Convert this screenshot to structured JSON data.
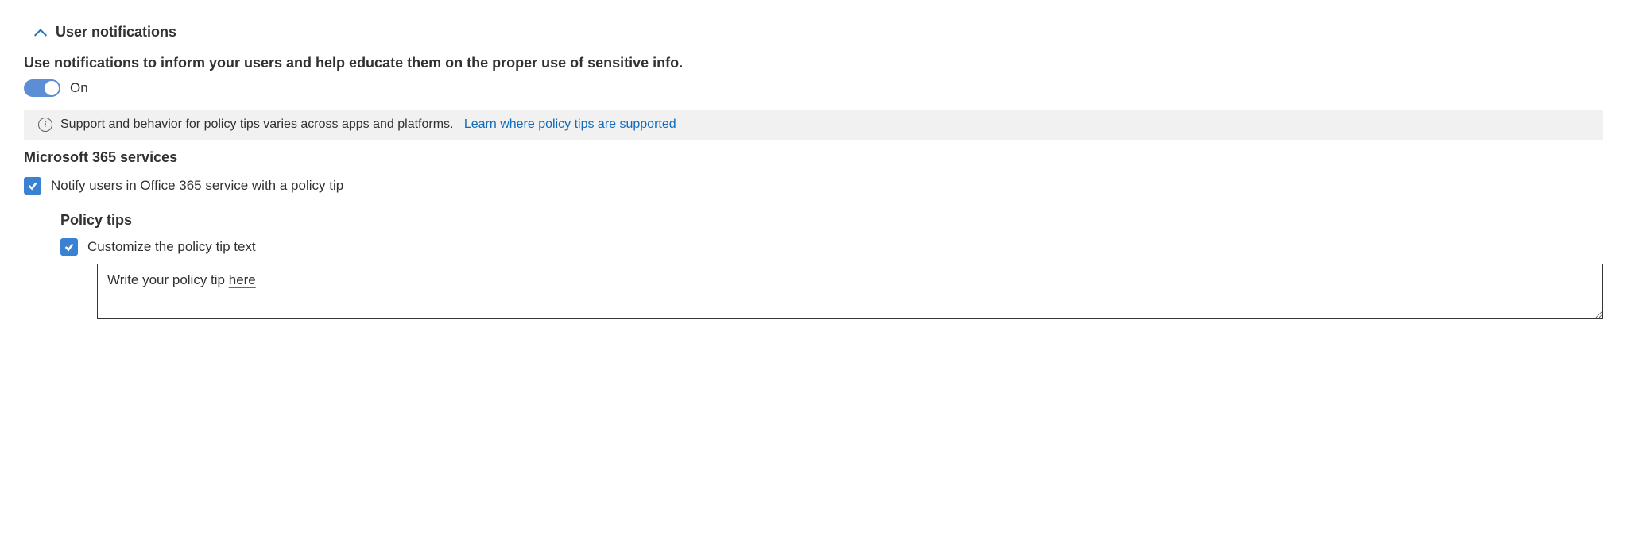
{
  "section": {
    "title": "User notifications",
    "description": "Use notifications to inform your users and help educate them on the proper use of sensitive info.",
    "toggle": {
      "state": "On"
    }
  },
  "infoBanner": {
    "text": "Support and behavior for policy tips varies across apps and platforms.",
    "linkText": "Learn where policy tips are supported"
  },
  "m365": {
    "title": "Microsoft 365 services",
    "checkbox1Label": "Notify users in Office 365 service with a policy tip"
  },
  "policyTips": {
    "title": "Policy tips",
    "customizeLabel": "Customize the policy tip text",
    "textValuePrefix": "Write your policy tip ",
    "textValueUnderlined": "here"
  }
}
